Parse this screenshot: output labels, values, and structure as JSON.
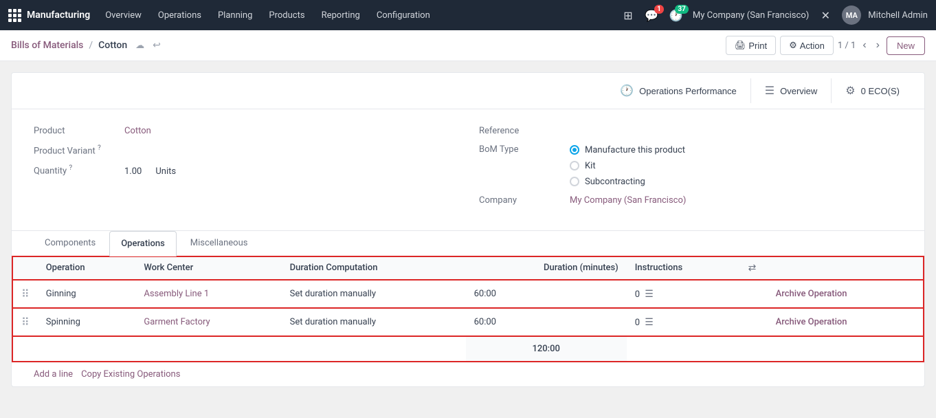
{
  "navbar": {
    "brand": "Manufacturing",
    "nav_items": [
      "Overview",
      "Operations",
      "Planning",
      "Products",
      "Reporting",
      "Configuration"
    ],
    "badge_chat": "1",
    "badge_activity": "37",
    "company": "My Company (San Francisco)",
    "user": "Mitchell Admin",
    "user_initials": "MA"
  },
  "breadcrumb": {
    "link": "Bills of Materials",
    "separator": "/",
    "current": "Cotton",
    "print_label": "Print",
    "action_label": "Action",
    "pagination": "1 / 1",
    "new_label": "New"
  },
  "action_buttons": {
    "operations_performance_label": "Operations Performance",
    "overview_label": "Overview",
    "eco_count": "0",
    "eco_label": "ECO(S)"
  },
  "form": {
    "product_label": "Product",
    "product_value": "Cotton",
    "product_variant_label": "Product Variant",
    "product_variant_superscript": "?",
    "quantity_label": "Quantity",
    "quantity_superscript": "?",
    "quantity_value": "1.00",
    "quantity_unit": "Units",
    "reference_label": "Reference",
    "bom_type_label": "BoM Type",
    "bom_types": [
      {
        "value": "manufacture",
        "label": "Manufacture this product",
        "checked": true
      },
      {
        "value": "kit",
        "label": "Kit",
        "checked": false
      },
      {
        "value": "subcontracting",
        "label": "Subcontracting",
        "checked": false
      }
    ],
    "company_label": "Company",
    "company_value": "My Company (San Francisco)"
  },
  "tabs": [
    {
      "id": "components",
      "label": "Components"
    },
    {
      "id": "operations",
      "label": "Operations",
      "active": true
    },
    {
      "id": "miscellaneous",
      "label": "Miscellaneous"
    }
  ],
  "operations_table": {
    "columns": [
      {
        "id": "operation",
        "label": "Operation"
      },
      {
        "id": "work_center",
        "label": "Work Center"
      },
      {
        "id": "duration_computation",
        "label": "Duration Computation"
      },
      {
        "id": "duration_minutes",
        "label": "Duration (minutes)",
        "align": "right"
      },
      {
        "id": "instructions",
        "label": "Instructions"
      }
    ],
    "rows": [
      {
        "operation": "Ginning",
        "work_center": "Assembly Line",
        "work_center_num": "1",
        "duration_computation": "Set duration manually",
        "duration_minutes": "60:00",
        "instructions_count": "0",
        "archive_label": "Archive Operation"
      },
      {
        "operation": "Spinning",
        "work_center": "Garment Factory",
        "work_center_num": "",
        "duration_computation": "Set duration manually",
        "duration_minutes": "60:00",
        "instructions_count": "0",
        "archive_label": "Archive Operation"
      }
    ],
    "total": "120:00",
    "add_line_label": "Add a line",
    "copy_existing_label": "Copy Existing Operations"
  }
}
